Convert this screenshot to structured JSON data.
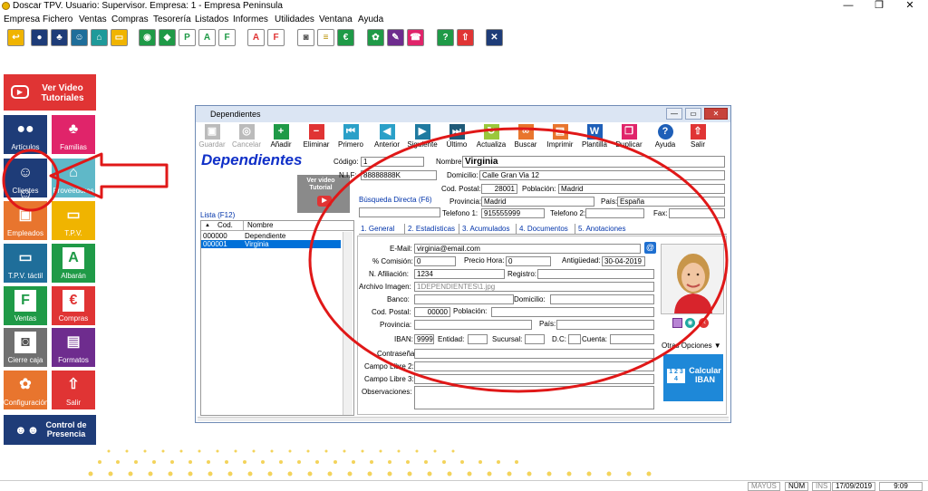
{
  "title": "Doscar TPV. Usuario: Supervisor. Empresa: 1 - Empresa Peninsula",
  "window_controls": {
    "minimize": "—",
    "maximize": "❐",
    "close": "✕"
  },
  "menu": [
    "Empresa",
    "Fichero",
    "Ventas",
    "Compras",
    "Tesorería",
    "Listados",
    "Informes",
    "Utilidades",
    "Ventana",
    "Ayuda"
  ],
  "sidebar": {
    "video": "Ver Video Tutoriales",
    "tiles": [
      "Artículos",
      "Familias",
      "Clientes",
      "Proveedores",
      "Empleados",
      "T.P.V.",
      "T.P.V. táctil",
      "Albarán",
      "Ventas",
      "Compras",
      "Cierre caja",
      "Formatos",
      "Configuración",
      "Salir"
    ],
    "control": "Control de Presencia"
  },
  "dialog": {
    "title": "Dependientes",
    "heading": "Dependientes",
    "ribbon": [
      "Guardar",
      "Cancelar",
      "Añadir",
      "Eliminar",
      "Primero",
      "Anterior",
      "Siguiente",
      "Último",
      "Actualiza",
      "Buscar",
      "Imprimir",
      "Plantilla",
      "Duplicar",
      "Ayuda",
      "Salir"
    ],
    "video_tutorial": "Ver video Tutorial",
    "lista_label": "Lista (F12)",
    "busqueda_label": "Búsqueda Directa (F6)",
    "list_headers": [
      "Cod.",
      "Nombre"
    ],
    "list_rows": [
      {
        "cod": "000000",
        "nombre": "Dependiente"
      },
      {
        "cod": "000001",
        "nombre": "Virginia"
      }
    ],
    "labels": {
      "codigo": "Código:",
      "nombre": "Nombre:",
      "nif": "N.I.F:",
      "domicilio": "Domicilio:",
      "cod_postal": "Cod. Postal:",
      "poblacion": "Población:",
      "provincia": "Provincia:",
      "pais": "País:",
      "telefono1": "Telefono 1:",
      "telefono2": "Telefono 2:",
      "fax": "Fax:"
    },
    "values": {
      "codigo": "1",
      "nombre": "Virginia",
      "nif": "88888888K",
      "domicilio": "Calle Gran Via 12",
      "cod_postal": "28001",
      "poblacion": "Madrid",
      "provincia": "Madrid",
      "pais": "España",
      "telefono1": "915555999",
      "telefono2": "",
      "fax": ""
    },
    "tabs": [
      "1. General",
      "2. Estadísticas",
      "3. Acumulados",
      "4. Documentos",
      "5. Anotaciones"
    ],
    "general": {
      "email_label": "E-Mail:",
      "email": "virginia@email.com",
      "comision_label": "% Comisión:",
      "comision": "0",
      "precio_hora_label": "Precio Hora:",
      "precio_hora": "0",
      "antiguedad_label": "Antigüedad:",
      "antiguedad": "30-04-2019",
      "afiliacion_label": "N. Afiliación:",
      "afiliacion": "1234",
      "registro_label": "Registro:",
      "imagen_label": "Archivo Imagen:",
      "imagen": "1DEPENDIENTES\\1.jpg",
      "banco_label": "Banco:",
      "domicilio_label": "Domicilio:",
      "cp_label": "Cod. Postal:",
      "cp": "00000",
      "poblacion_label": "Población:",
      "provincia_label": "Provincia:",
      "pais_label": "País:",
      "iban_label": "IBAN:",
      "iban": "9999",
      "entidad_label": "Entidad:",
      "sucursal_label": "Sucursal:",
      "dc_label": "D.C:",
      "cuenta_label": "Cuenta:",
      "contrasena_label": "Contraseña:",
      "campo1_label": "Campo Libre 2:",
      "campo2_label": "Campo Libre 3:",
      "observaciones_label": "Observaciones:"
    },
    "otras_opciones": "Otras Opciones ▼",
    "calcular": "Calcular IBAN",
    "iban_icon": "1 2 3 4"
  },
  "status": {
    "mayus": "MAYÚS",
    "num": "NÚM",
    "ins": "INS",
    "date": "17/09/2019",
    "time": "9:09"
  }
}
